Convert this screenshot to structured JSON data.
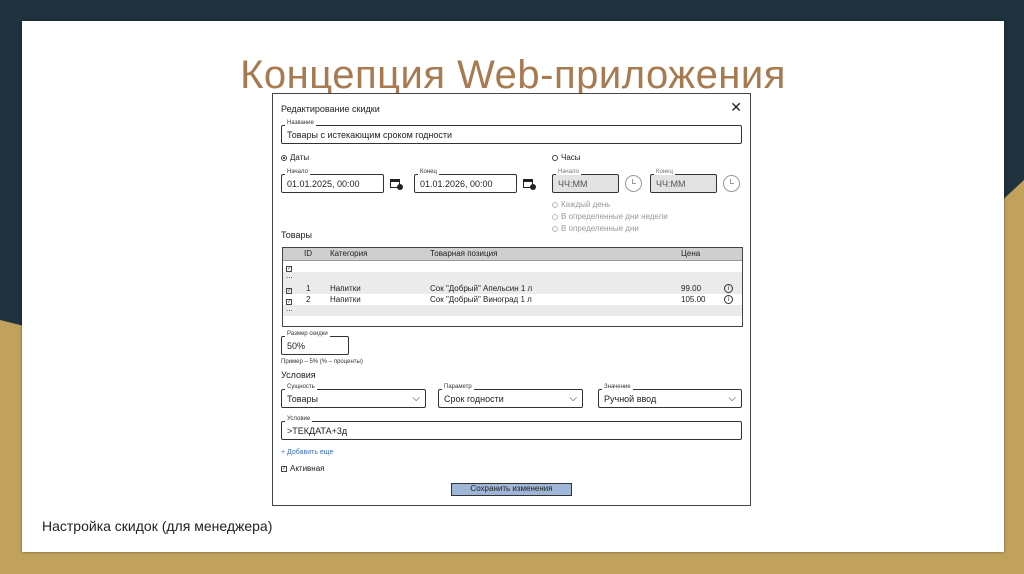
{
  "slide": {
    "title": "Концепция Web-приложения",
    "caption": "Настройка скидок (для менеджера)"
  },
  "dialog": {
    "title": "Редактирование скидки",
    "close_icon": "close-icon",
    "name": {
      "label": "Название",
      "value": "Товары с истекающим сроком годности"
    },
    "mode_dates": "Даты",
    "mode_hours": "Часы",
    "date_start": {
      "label": "Начало",
      "value": "01.01.2025, 00:00"
    },
    "date_end": {
      "label": "Конец",
      "value": "01.01.2026, 00:00"
    },
    "hour_start": {
      "label": "Начало",
      "value": "ЧЧ:ММ"
    },
    "hour_end": {
      "label": "Конец",
      "value": "ЧЧ:ММ"
    },
    "schedule": [
      "Каждый день",
      "В определенные дни недели",
      "В определенные дни"
    ],
    "products_title": "Товары",
    "table": {
      "headers": [
        "ID",
        "Категория",
        "Товарная позиция",
        "Цена"
      ],
      "rows": [
        {
          "id": "1",
          "category": "Напитки",
          "item": "Сок \"Добрый\" Апельсин 1 л",
          "price": "99.00"
        },
        {
          "id": "2",
          "category": "Напитки",
          "item": "Сок \"Добрый\" Виноград 1 л",
          "price": "105.00"
        }
      ],
      "ellipsis": "..."
    },
    "discount": {
      "label": "Размер скидки",
      "value": "50%",
      "hint": "Пример – 5% (% – проценты)"
    },
    "conditions_title": "Условия",
    "entity": {
      "label": "Сущность",
      "value": "Товары"
    },
    "param": {
      "label": "Параметр",
      "value": "Срок годности"
    },
    "val": {
      "label": "Значение",
      "value": "Ручной ввод"
    },
    "condition": {
      "label": "Условие",
      "value": ">ТЕКДАТА+3д"
    },
    "add_more": "+ Добавить еще",
    "active": "Активная",
    "save": "Сохранить изменения"
  },
  "colors": {
    "title": "#a87a50",
    "accent": "#9fb6d6",
    "dark": "#1f323d",
    "gold": "#c1a25c"
  }
}
